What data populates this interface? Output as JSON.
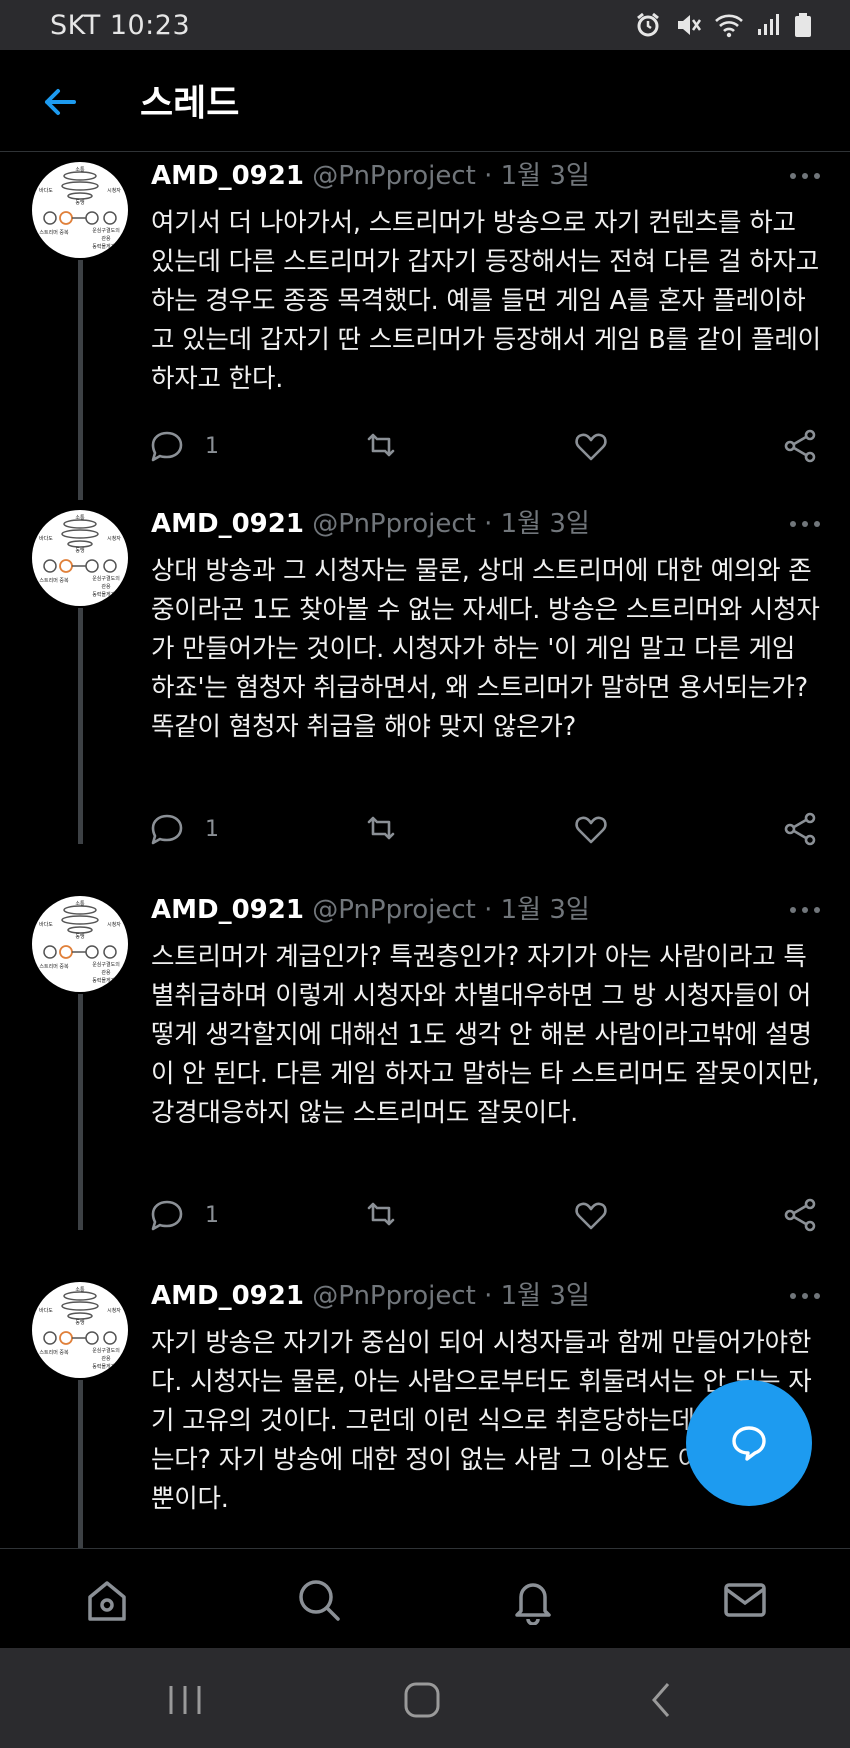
{
  "status_bar": {
    "carrier_time": "SKT 10:23"
  },
  "header": {
    "title": "스레드"
  },
  "tweets": [
    {
      "name": "AMD_0921",
      "meta": "@PnPproject · 1월 3일",
      "text": "여기서 더 나아가서, 스트리머가 방송으로 자기 컨텐츠를 하고 있는데 다른 스트리머가 갑자기 등장해서는 전혀 다른 걸 하자고 하는 경우도 종종 목격했다. 예를 들면 게임 A를 혼자 플레이하고 있는데 갑자기 딴 스트리머가 등장해서 게임 B를 같이 플레이하자고 한다.",
      "reply_count": "1"
    },
    {
      "name": "AMD_0921",
      "meta": "@PnPproject · 1월 3일",
      "text": "상대 방송과 그 시청자는 물론, 상대 스트리머에 대한 예의와 존중이라곤 1도 찾아볼 수 없는 자세다. 방송은 스트리머와 시청자가 만들어가는 것이다. 시청자가 하는 '이 게임 말고 다른 게임 하죠'는 혐청자 취급하면서, 왜 스트리머가 말하면 용서되는가? 똑같이 혐청자 취급을 해야 맞지 않은가?",
      "reply_count": "1"
    },
    {
      "name": "AMD_0921",
      "meta": "@PnPproject · 1월 3일",
      "text": "스트리머가 계급인가? 특권층인가? 자기가 아는 사람이라고 특별취급하며 이렇게 시청자와 차별대우하면 그 방 시청자들이 어떻게 생각할지에 대해선 1도 생각 안 해본 사람이라고밖에 설명이 안 된다. 다른 게임 하자고 말하는 타 스트리머도 잘못이지만, 강경대응하지 않는 스트리머도 잘못이다.",
      "reply_count": "1"
    },
    {
      "name": "AMD_0921",
      "meta": "@PnPproject · 1월 3일",
      "text": "자기 방송은 자기가 중심이 되어 시청자들과 함께 만들어가야한다. 시청자는 물론, 아는 사람으로부터도 휘둘려서는 안 되는 자기 고유의 것이다. 그런데 이런 식으로 취흔당하는데 가만히 있는다? 자기 방송에 대한 정이 없는 사람 그 이상도 이하도 아닐 뿐이다.",
      "reply_count": ""
    }
  ],
  "avatar_labels": [
    "바다도",
    "소통",
    "시청자",
    "동맹",
    "스트리머 중복",
    "운심구결도의",
    "관용",
    "동력몰게개방"
  ],
  "colors": {
    "accent": "#1d9bf0",
    "muted": "#71767b",
    "background": "#000000"
  },
  "icons": {
    "back": "arrow-left-icon",
    "more": "more-horizontal-icon",
    "reply": "chat-bubble-icon",
    "retweet": "retweet-icon",
    "like": "heart-icon",
    "share": "share-icon",
    "compose": "compose-reply-icon",
    "home": "home-icon",
    "search": "search-icon",
    "notifications": "bell-icon",
    "messages": "mail-icon"
  }
}
